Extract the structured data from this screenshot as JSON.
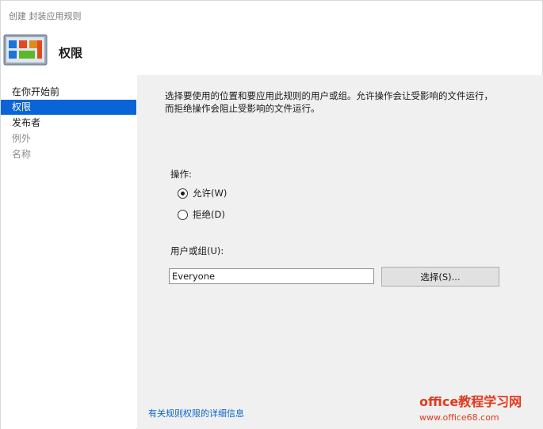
{
  "window": {
    "title": "创建 封装应用规则"
  },
  "header": {
    "title": "权限",
    "icon": "app-rule-icon"
  },
  "sidebar": {
    "items": [
      {
        "label": "在你开始前",
        "state": "normal"
      },
      {
        "label": "权限",
        "state": "selected"
      },
      {
        "label": "发布者",
        "state": "normal"
      },
      {
        "label": "例外",
        "state": "disabled"
      },
      {
        "label": "名称",
        "state": "disabled"
      }
    ]
  },
  "content": {
    "description_line1": "选择要使用的位置和要应用此规则的用户或组。允许操作会让受影响的文件运行，",
    "description_line2": "而拒绝操作会阻止受影响的文件运行。",
    "action_label": "操作:",
    "options": [
      {
        "label": "允许(W)",
        "checked": true
      },
      {
        "label": "拒绝(D)",
        "checked": false
      }
    ],
    "user_label": "用户或组(U):",
    "user_value": "Everyone",
    "select_button": "选择(S)...",
    "more_info_link": "有关规则权限的详细信息"
  },
  "watermark": {
    "line1": "office教程学习网",
    "line2": "www.office68.com"
  },
  "colors": {
    "selected_bg": "#0a64d7",
    "content_bg": "#f0f0f0",
    "link": "#0a64c8",
    "watermark": "#e03a1e"
  }
}
